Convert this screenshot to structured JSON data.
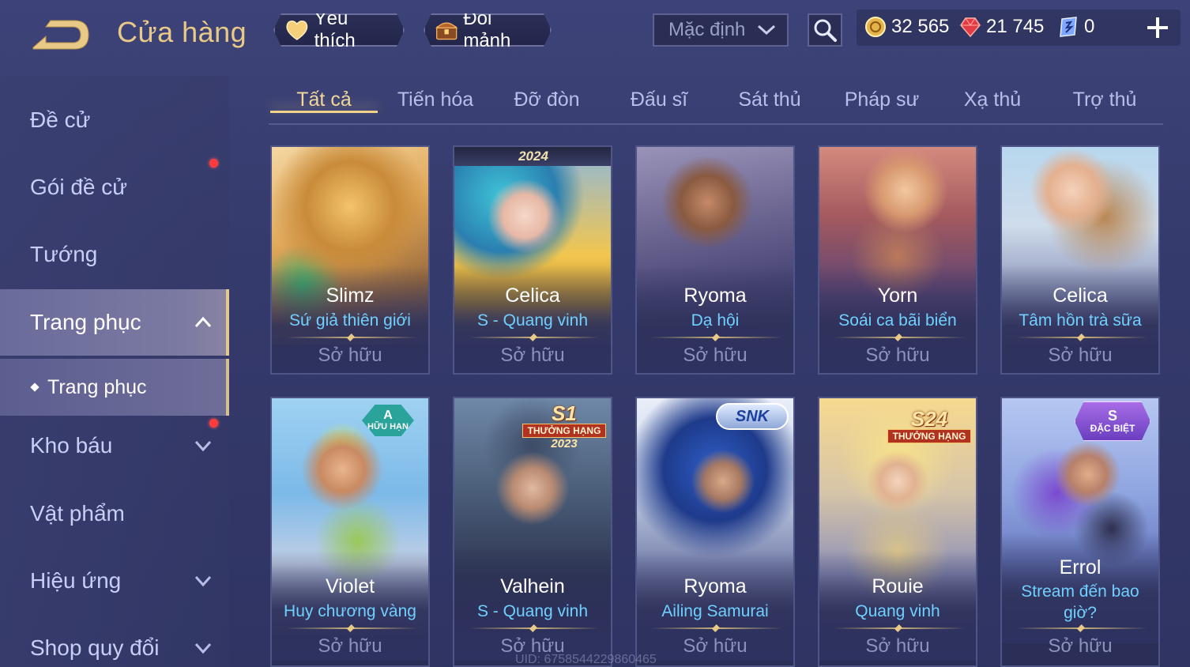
{
  "header": {
    "title": "Cửa hàng",
    "favorites_label": "Yêu thích",
    "exchange_label": "Đổi mảnh",
    "sort_value": "Mặc định"
  },
  "currency": {
    "gold": "32 565",
    "ruby": "21 745",
    "voucher": "0"
  },
  "sidebar": {
    "items": [
      {
        "label": "Đề cử"
      },
      {
        "label": "Gói đề cử"
      },
      {
        "label": "Tướng"
      },
      {
        "label": "Trang phục"
      },
      {
        "label": "Kho báu"
      },
      {
        "label": "Vật phẩm"
      },
      {
        "label": "Hiệu ứng"
      },
      {
        "label": "Shop quy đổi"
      }
    ],
    "sub_item": "Trang phục"
  },
  "tabs": [
    "Tất cả",
    "Tiến hóa",
    "Đỡ đòn",
    "Đấu sĩ",
    "Sát thủ",
    "Pháp sư",
    "Xạ thủ",
    "Trợ thủ"
  ],
  "owned_label": "Sở hữu",
  "cards": [
    {
      "hero": "Slimz",
      "skin": "Sứ giả thiên giới"
    },
    {
      "hero": "Celica",
      "skin": "S - Quang vinh",
      "badge": "2024"
    },
    {
      "hero": "Ryoma",
      "skin": "Dạ hội"
    },
    {
      "hero": "Yorn",
      "skin": "Soái ca bãi biển"
    },
    {
      "hero": "Celica",
      "skin": "Tâm hồn trà sữa"
    },
    {
      "hero": "Violet",
      "skin": "Huy chương vàng",
      "badge_top": "A",
      "badge_bottom": "HỮU HẠN"
    },
    {
      "hero": "Valhein",
      "skin": "S - Quang vinh",
      "badge_top": "S1",
      "badge_mid": "THƯỞNG HẠNG",
      "badge_bottom": "2023"
    },
    {
      "hero": "Ryoma",
      "skin": "Ailing Samurai",
      "badge": "SNK"
    },
    {
      "hero": "Rouie",
      "skin": "Quang vinh",
      "badge_top": "S24",
      "badge_mid": "THƯỞNG HẠNG"
    },
    {
      "hero": "Errol",
      "skin": "Stream đến bao giờ?",
      "badge_top": "S",
      "badge_bottom": "ĐẶC BIỆT"
    }
  ],
  "uid": "UID: 6758544229860465",
  "colors": {
    "accent_gold": "#e9c987",
    "skin_name_blue": "#6fd0ff",
    "notification_red": "#ff3b3b"
  }
}
